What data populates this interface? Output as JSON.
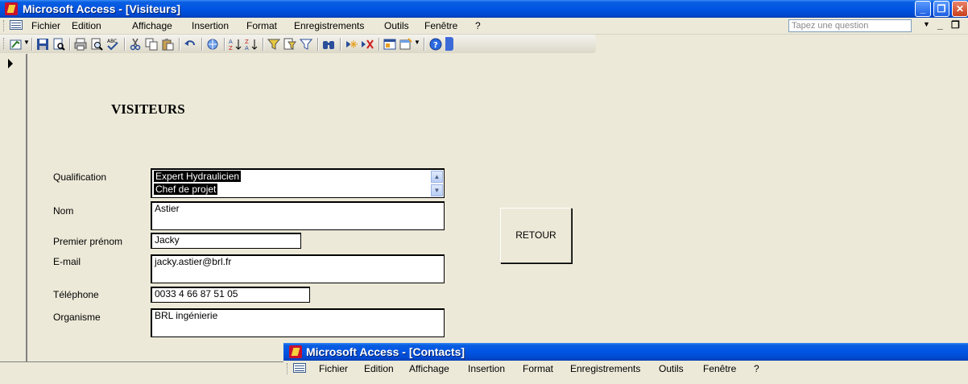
{
  "colors": {
    "title_bar": "#0054e3",
    "chrome": "#ece9d8",
    "selection": "#000000"
  },
  "main_window": {
    "title": "Microsoft Access - [Visiteurs]",
    "menu": [
      "Fichier",
      "Edition",
      "Affichage",
      "Insertion",
      "Format",
      "Enregistrements",
      "Outils",
      "Fenêtre",
      "?"
    ],
    "question_placeholder": "Tapez une question",
    "toolbar_icons": [
      "view-icon",
      "save-icon",
      "search-file-icon",
      "print-icon",
      "print-preview-icon",
      "spelling-icon",
      "cut-icon",
      "copy-icon",
      "paste-icon",
      "undo-icon",
      "hyperlink-icon",
      "sort-ascending-icon",
      "sort-descending-icon",
      "filter-by-selection-icon",
      "filter-by-form-icon",
      "apply-filter-icon",
      "find-icon",
      "new-record-icon",
      "delete-record-icon",
      "database-window-icon",
      "new-object-icon",
      "help-icon"
    ]
  },
  "form": {
    "heading": "VISITEURS",
    "labels": {
      "qualification": "Qualification",
      "nom": "Nom",
      "prenom": "Premier prénom",
      "email": "E-mail",
      "telephone": "Téléphone",
      "organisme": "Organisme"
    },
    "qualification_items": [
      "Expert Hydraulicien",
      "Chef de projet"
    ],
    "values": {
      "nom": "Astier",
      "prenom": "Jacky",
      "email": "jacky.astier@brl.fr",
      "telephone": "0033 4 66 87 51 05",
      "organisme": "BRL ingénierie"
    },
    "retour_label": "RETOUR"
  },
  "second_window": {
    "title": "Microsoft Access - [Contacts]",
    "menu": [
      "Fichier",
      "Edition",
      "Affichage",
      "Insertion",
      "Format",
      "Enregistrements",
      "Outils",
      "Fenêtre",
      "?"
    ]
  }
}
